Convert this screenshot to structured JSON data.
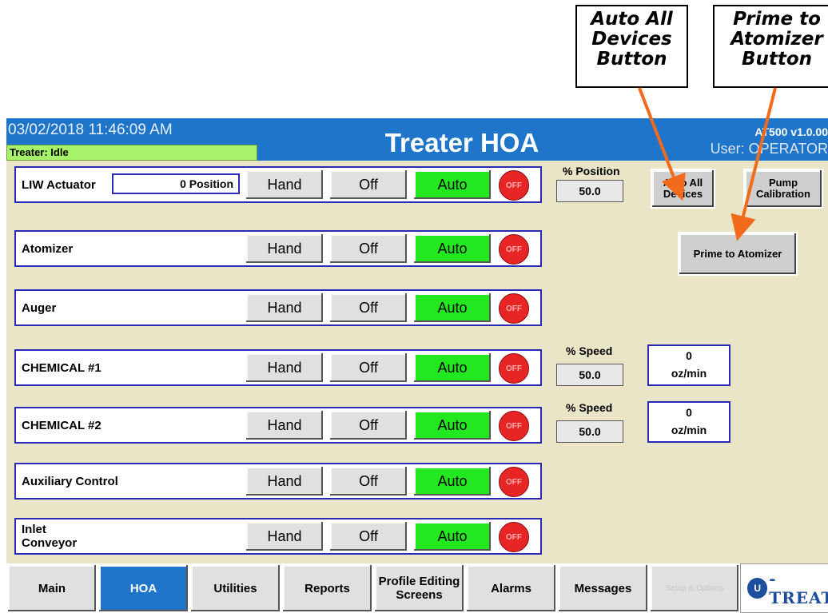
{
  "callouts": {
    "auto_all": [
      "Auto All",
      "Devices",
      "Button"
    ],
    "prime": [
      "Prime to",
      "Atomizer",
      "Button"
    ]
  },
  "header": {
    "timestamp": "03/02/2018 11:46:09 AM",
    "status": "Treater: Idle",
    "title": "Treater HOA",
    "version": "AT500 v1.0.00",
    "user": "User: OPERATOR"
  },
  "devices": [
    {
      "label": "LIW Actuator",
      "position": "0 Position",
      "hand": "Hand",
      "off": "Off",
      "auto": "Auto",
      "state": "OFF"
    },
    {
      "label": "Atomizer",
      "hand": "Hand",
      "off": "Off",
      "auto": "Auto",
      "state": "OFF"
    },
    {
      "label": "Auger",
      "hand": "Hand",
      "off": "Off",
      "auto": "Auto",
      "state": "OFF"
    },
    {
      "label": "CHEMICAL #1",
      "hand": "Hand",
      "off": "Off",
      "auto": "Auto",
      "state": "OFF"
    },
    {
      "label": "CHEMICAL #2",
      "hand": "Hand",
      "off": "Off",
      "auto": "Auto",
      "state": "OFF"
    },
    {
      "label": "Auxiliary Control",
      "hand": "Hand",
      "off": "Off",
      "auto": "Auto",
      "state": "OFF"
    },
    {
      "label": "Inlet Conveyor",
      "hand": "Hand",
      "off": "Off",
      "auto": "Auto",
      "state": "OFF"
    }
  ],
  "panel": {
    "position_label": "% Position",
    "position_value": "50.0",
    "auto_all_label": "Auto All Devices",
    "pump_cal_label": "Pump Calibration",
    "prime_label": "Prime to Atomizer",
    "chem1": {
      "speed_label": "% Speed",
      "speed_value": "50.0",
      "flow_value": "0",
      "flow_unit": "oz/min"
    },
    "chem2": {
      "speed_label": "% Speed",
      "speed_value": "50.0",
      "flow_value": "0",
      "flow_unit": "oz/min"
    }
  },
  "tabs": [
    {
      "label": "Main"
    },
    {
      "label": "HOA",
      "active": true
    },
    {
      "label": "Utilities"
    },
    {
      "label": "Reports"
    },
    {
      "label": "Profile Editing Screens"
    },
    {
      "label": "Alarms"
    },
    {
      "label": "Messages"
    },
    {
      "label": "Setup & Options",
      "disabled": true
    }
  ],
  "logo": {
    "mark": "U",
    "text": "-TREAT"
  },
  "colors": {
    "title_bar": "#1f75c9",
    "auto_active": "#23e820",
    "indicator_off": "#e82525",
    "status_bg": "#a6f26a",
    "screen_bg": "#ebe5c8",
    "arrow": "#f26b1d"
  }
}
